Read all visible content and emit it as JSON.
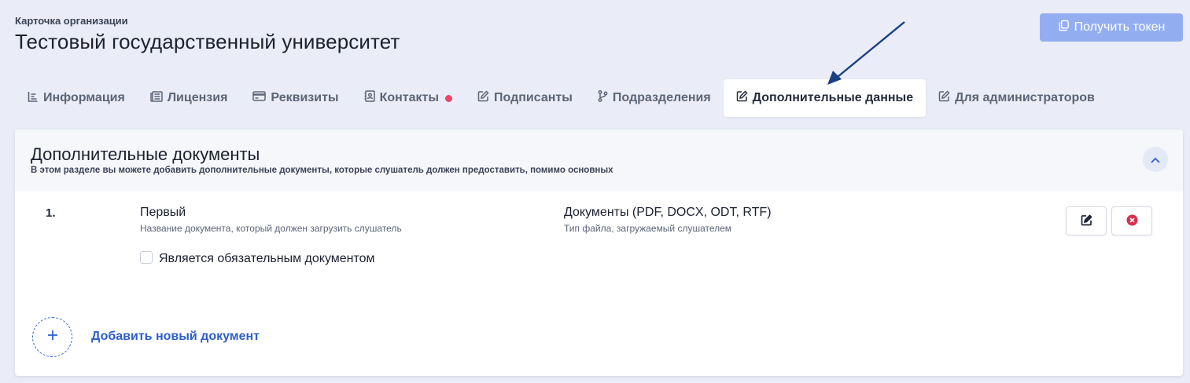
{
  "header": {
    "breadcrumb": "Карточка организации",
    "title": "Тестовый государственный университет",
    "token_button_label": "Получить токен"
  },
  "tabs": [
    {
      "label": "Информация",
      "icon": "list-icon"
    },
    {
      "label": "Лицензия",
      "icon": "newspaper-icon"
    },
    {
      "label": "Реквизиты",
      "icon": "credit-card-icon"
    },
    {
      "label": "Контакты",
      "icon": "contact-card-icon",
      "badge": true
    },
    {
      "label": "Подписанты",
      "icon": "edit-icon"
    },
    {
      "label": "Подразделения",
      "icon": "branch-icon"
    },
    {
      "label": "Дополнительные данные",
      "icon": "edit-icon",
      "active": true
    },
    {
      "label": "Для администраторов",
      "icon": "edit-icon"
    }
  ],
  "section": {
    "title": "Дополнительные документы",
    "subtitle": "В этом разделе вы можете добавить дополнительные документы, которые слушатель должен предоставить, помимо основных",
    "documents": [
      {
        "number": "1.",
        "name": "Первый",
        "name_hint": "Название документа, который должен загрузить слушатель",
        "file_type": "Документы (PDF, DOCX, ODT, RTF)",
        "file_type_hint": "Тип файла, загружаемый слушателем",
        "required_label": "Является обязательным документом",
        "required": false
      }
    ],
    "add_label": "Добавить новый документ"
  },
  "colors": {
    "accent": "#2d5fc9",
    "token_button": "#93aef0",
    "badge": "#e8466a",
    "delete": "#d9304f",
    "background": "#eaedf7"
  }
}
